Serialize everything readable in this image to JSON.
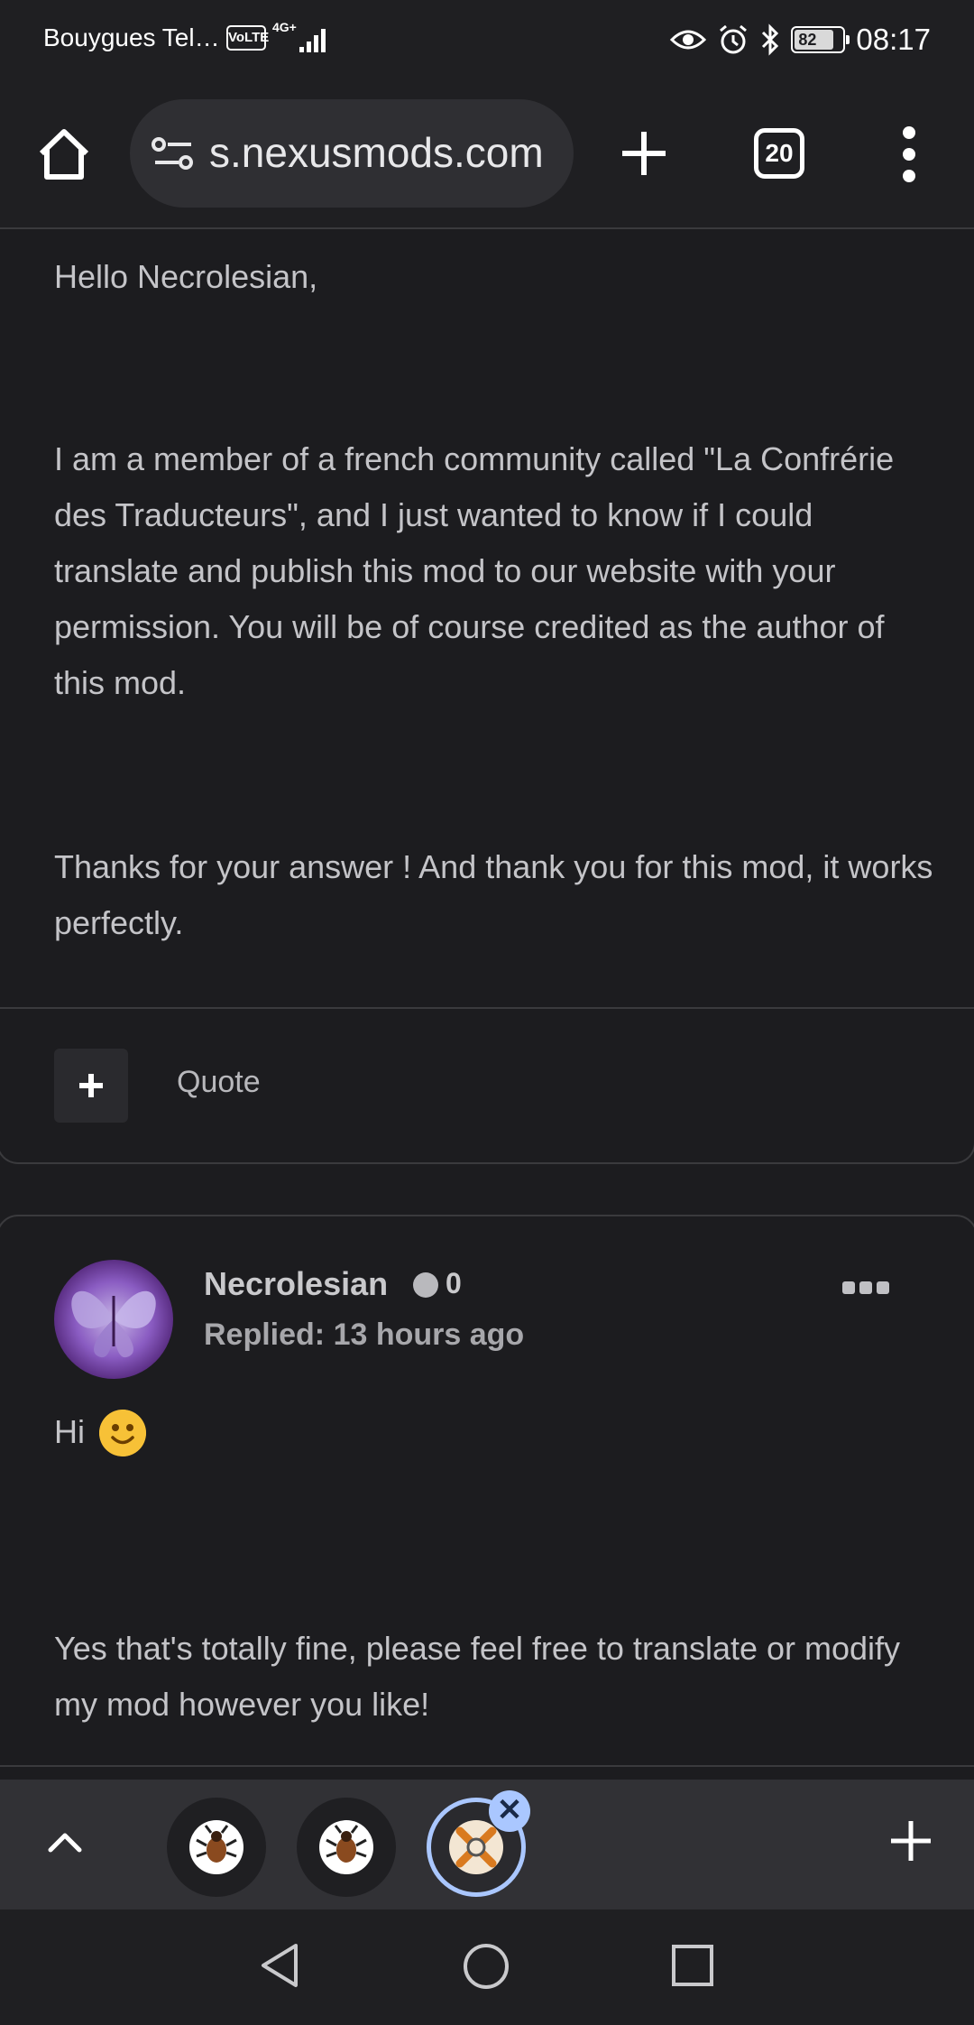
{
  "status_bar": {
    "carrier": "Bouygues Tel…",
    "volte": "VoLTE",
    "network": "4G+",
    "battery": "82",
    "time": "08:17"
  },
  "browser": {
    "url": "s.nexusmods.com",
    "tab_count": "20"
  },
  "post1": {
    "greeting": "Hello Necrolesian,",
    "body": "I am a member of a french community called \"La Confrérie des Traducteurs\", and I just wanted to know if I could translate and publish this mod to our website with your permission. You will be of course credited as the author of this mod.",
    "thanks": "Thanks for your answer ! And thank you for this mod, it works perfectly.",
    "quote_label": "Quote"
  },
  "post2": {
    "author": "Necrolesian",
    "kudos": "0",
    "replied": "Replied: 13 hours ago",
    "greeting": "Hi",
    "body": "Yes that's totally fine, please feel free to translate or modify my mod however you like!"
  },
  "icons": {
    "home": "home-icon",
    "site_settings": "site-settings-icon",
    "new_tab": "plus-icon",
    "menu": "more-vert-icon",
    "collapse": "chevron-up-icon",
    "close": "close-icon",
    "back": "back-triangle-icon",
    "home_nav": "home-circle-icon",
    "recents": "recents-square-icon"
  },
  "colors": {
    "background": "#1c1c1f",
    "accent": "#aac7ff",
    "text": "#c4c4c8"
  }
}
